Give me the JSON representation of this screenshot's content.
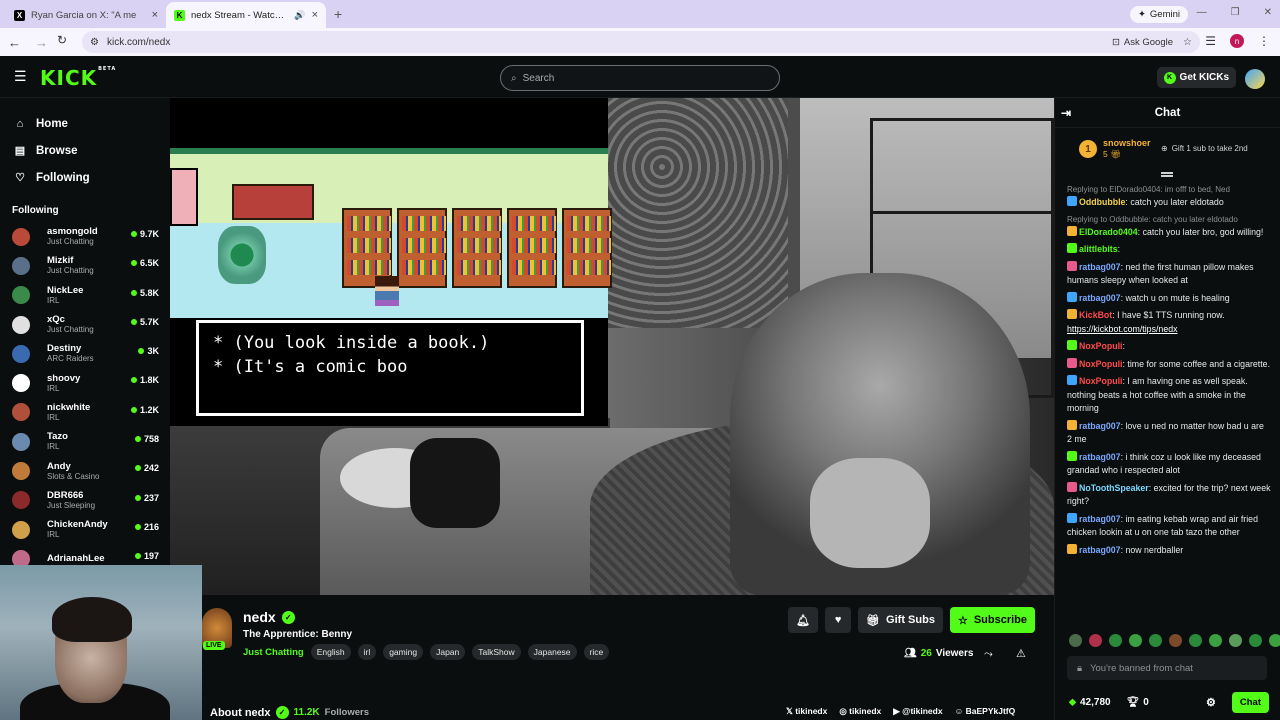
{
  "browser": {
    "tabs": [
      {
        "title": "Ryan Garcia on X: \"A me",
        "favicon": "X",
        "active": false
      },
      {
        "title": "nedx Stream - Watch Live o",
        "favicon": "K",
        "active": true
      }
    ],
    "gemini_label": "Gemini",
    "url": "kick.com/nedx",
    "ask_google": "Ask Google",
    "profile_initial": "n"
  },
  "header": {
    "logo": "KICK",
    "logo_badge": "BETA",
    "search_placeholder": "Search",
    "get_kicks": "Get KICKs"
  },
  "nav": [
    {
      "label": "Home",
      "icon": "home-icon"
    },
    {
      "label": "Browse",
      "icon": "browse-icon"
    },
    {
      "label": "Following",
      "icon": "heart-icon"
    }
  ],
  "following_heading": "Following",
  "following": [
    {
      "name": "asmongold",
      "category": "Just Chatting",
      "viewers": "9.7K",
      "color": "#b94a3a"
    },
    {
      "name": "Mizkif",
      "category": "Just Chatting",
      "viewers": "6.5K",
      "color": "#5a6f8a"
    },
    {
      "name": "NickLee",
      "category": "IRL",
      "viewers": "5.8K",
      "color": "#3a8a4a"
    },
    {
      "name": "xQc",
      "category": "Just Chatting",
      "viewers": "5.7K",
      "color": "#e0e0e0"
    },
    {
      "name": "Destiny",
      "category": "ARC Raiders",
      "viewers": "3K",
      "color": "#3a6ab0"
    },
    {
      "name": "shoovy",
      "category": "IRL",
      "viewers": "1.8K",
      "color": "#ffffff"
    },
    {
      "name": "nickwhite",
      "category": "IRL",
      "viewers": "1.2K",
      "color": "#b0503a"
    },
    {
      "name": "Tazo",
      "category": "IRL",
      "viewers": "758",
      "color": "#6a8ab0"
    },
    {
      "name": "Andy",
      "category": "Slots & Casino",
      "viewers": "242",
      "color": "#c07a3a"
    },
    {
      "name": "DBR666",
      "category": "Just Sleeping",
      "viewers": "237",
      "color": "#8a2a2a"
    },
    {
      "name": "ChickenAndy",
      "category": "IRL",
      "viewers": "216",
      "color": "#d0a04a"
    },
    {
      "name": "AdrianahLee",
      "category": "",
      "viewers": "197",
      "color": "#c06a8a"
    }
  ],
  "game": {
    "line1": "* (You look inside a book.)",
    "line2": "* (It's a comic boo"
  },
  "stream": {
    "name": "nedx",
    "live": "LIVE",
    "title": "The Apprentice: Benny",
    "category": "Just Chatting",
    "tags": [
      "English",
      "irl",
      "gaming",
      "Japan",
      "TalkShow",
      "Japanese",
      "rice"
    ],
    "gift_subs": "Gift Subs",
    "subscribe": "Subscribe",
    "viewers_count": "26",
    "viewers_label": "Viewers",
    "about": "About nedx",
    "followers_count": "11.2K",
    "followers_label": "Followers",
    "socials": [
      "tikinedx",
      "tikinedx",
      "@tikinedx",
      "BaEPYkJtfQ"
    ]
  },
  "chat": {
    "title": "Chat",
    "pinned_user": "snowshoer",
    "pinned_rank": "1",
    "pinned_count": "5",
    "gift_prompt": "Gift 1 sub to take 2nd",
    "messages": [
      {
        "reply": "Replying to ElDorado0404: im offf to bed, Ned",
        "user": "Oddbubble",
        "color": "#f3d349",
        "text": "catch you later eldotado"
      },
      {
        "reply": "Replying to Oddbubble: catch you later eldotado",
        "user": "ElDorado0404",
        "color": "#53fc18",
        "text": "catch you later bro, god willing!"
      },
      {
        "reply": "",
        "user": "alittlebits",
        "color": "#53fc18",
        "text": ""
      },
      {
        "reply": "",
        "user": "ratbag007",
        "color": "#7aa9ff",
        "text": "ned the first human pillow makes humans sleepy when looked at"
      },
      {
        "reply": "",
        "user": "ratbag007",
        "color": "#7aa9ff",
        "text": "watch u on mute is healing"
      },
      {
        "reply": "",
        "user": "KickBot",
        "color": "#ff4a4a",
        "text": "I have $1 TTS running now.",
        "link": "https://kickbot.com/tips/nedx"
      },
      {
        "reply": "",
        "user": "NoxPopuli",
        "color": "#ff4a4a",
        "text": ""
      },
      {
        "reply": "",
        "user": "NoxPopuli",
        "color": "#ff4a4a",
        "text": "time for some coffee and a cigarette."
      },
      {
        "reply": "",
        "user": "NoxPopuli",
        "color": "#ff4a4a",
        "text": "I am having one as well speak. nothing beats a hot coffee with a smoke in the morning"
      },
      {
        "reply": "",
        "user": "ratbag007",
        "color": "#7aa9ff",
        "text": "love u ned no matter how bad u are 2 me"
      },
      {
        "reply": "",
        "user": "ratbag007",
        "color": "#7aa9ff",
        "text": "i think coz u look like my deceased grandad who i respected alot"
      },
      {
        "reply": "",
        "user": "NoToothSpeaker",
        "color": "#7ad8ff",
        "text": "excited for the trip? next week right?"
      },
      {
        "reply": "",
        "user": "ratbag007",
        "color": "#7aa9ff",
        "text": "im eating kebab wrap and air fried chicken lookin at u on one tab tazo the other"
      },
      {
        "reply": "",
        "user": "ratbag007",
        "color": "#7aa9ff",
        "text": "now nerdballer"
      }
    ],
    "input_placeholder": "You're banned from chat",
    "points": "42,780",
    "count": "0",
    "chat_button": "Chat"
  }
}
